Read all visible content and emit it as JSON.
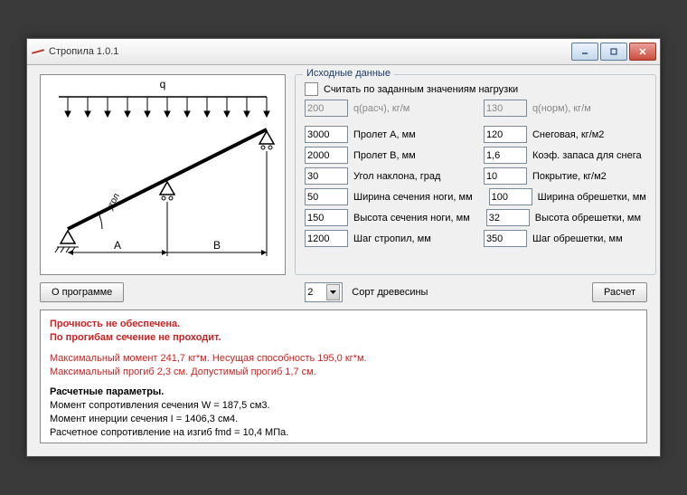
{
  "window": {
    "title": "Стропила 1.0.1"
  },
  "inputs_header": "Исходные данные",
  "checkbox_label": "Считать по заданным значениям нагрузки",
  "q_calc": {
    "value": "200",
    "label": "q(расч), кг/м"
  },
  "q_norm": {
    "value": "130",
    "label": "q(норм), кг/м"
  },
  "left_fields": [
    {
      "value": "3000",
      "label": "Пролет А, мм"
    },
    {
      "value": "2000",
      "label": "Пролет В, мм"
    },
    {
      "value": "30",
      "label": "Угол наклона, град"
    },
    {
      "value": "50",
      "label": "Ширина сечения ноги, мм"
    },
    {
      "value": "150",
      "label": "Высота сечения ноги, мм"
    },
    {
      "value": "1200",
      "label": "Шаг стропил, мм"
    }
  ],
  "right_fields": [
    {
      "value": "120",
      "label": "Снеговая, кг/м2"
    },
    {
      "value": "1,6",
      "label": "Коэф. запаса для снега"
    },
    {
      "value": "10",
      "label": "Покрытие, кг/м2"
    },
    {
      "value": "100",
      "label": "Ширина обрешетки, мм"
    },
    {
      "value": "32",
      "label": "Высота обрешетки, мм"
    },
    {
      "value": "350",
      "label": "Шаг обрешетки, мм"
    }
  ],
  "about_btn": "О программе",
  "wood_grade": {
    "value": "2",
    "label": "Сорт древесины"
  },
  "calc_btn": "Расчет",
  "diagram": {
    "q": "q",
    "A": "A",
    "B": "B",
    "angle": "угол"
  },
  "results": {
    "l1": "Прочность не обеспечена.",
    "l2": "По прогибам сечение не проходит.",
    "l3": "Максимальный момент 241,7 кг*м. Несущая способность 195,0 кг*м.",
    "l4": "Максимальный прогиб 2,3 см. Допустимый прогиб 1,7 см.",
    "l5": "Расчетные параметры.",
    "l6": "Момент сопротивления сечения W = 187,5 см3.",
    "l7": "Момент инерции сечения I = 1406,3 см4.",
    "l8": "Расчетное сопротивление на изгиб fmd = 10,4 МПа."
  }
}
